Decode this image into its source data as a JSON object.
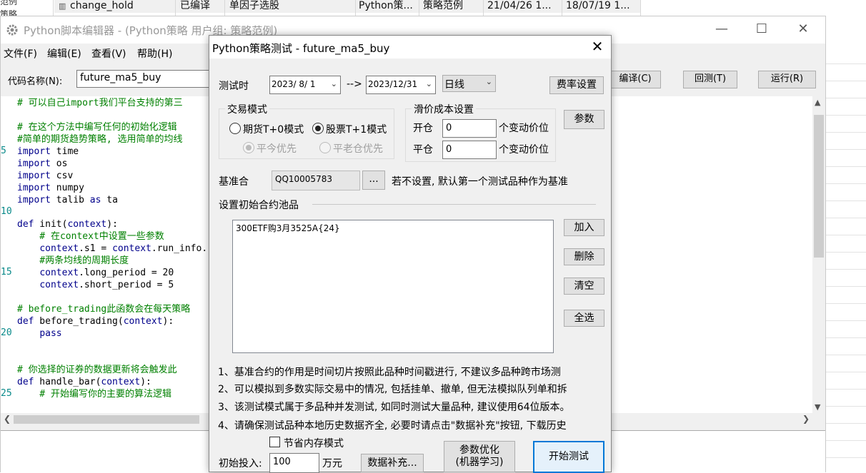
{
  "background_row": {
    "left_fragments": [
      "范例",
      "策略"
    ],
    "name": "change_hold",
    "status": "已编译",
    "category": "单因子选股",
    "language": "Python策...",
    "group": "策略范例",
    "created": "21/04/26 1...",
    "modified": "18/07/19 1..."
  },
  "editor": {
    "title": "Python脚本编辑器 - (Python策略 用户组: 策略范例)",
    "menu": [
      "文件(F)",
      "编辑(E)",
      "查看(V)",
      "帮助(H)"
    ],
    "code_name_label": "代码名称(N):",
    "code_name_value": "future_ma5_buy",
    "buttons": {
      "compile": "编译(C)",
      "backtest": "回测(T)",
      "run": "运行(R)"
    },
    "line_numbers": [
      "5",
      "10",
      "15",
      "20",
      "25"
    ],
    "code_lines": [
      "# 可以自己import我们平台支持的第三",
      "",
      "# 在这个方法中编写任何的初始化逻辑",
      "#简单的期货趋势策略, 选用简单的均线",
      "import time",
      "import os",
      "import csv",
      "import numpy",
      "import talib as ta",
      "",
      "def init(context):",
      "    # 在context中设置一些参数",
      "    context.s1 = context.run_info.",
      "    #两条均线的周期长度",
      "    context.long_period = 20",
      "    context.short_period = 5",
      "",
      "# before_trading此函数会在每天策略",
      "def before_trading(context):",
      "    pass",
      "",
      "",
      "# 你选择的证券的数据更新将会触发此",
      "def handle_bar(context):",
      "    # 开始编写你的主要的算法逻辑"
    ]
  },
  "dialog": {
    "title": "Python策略测试 - future_ma5_buy",
    "test_time_label": "测试时",
    "start_date": "2023/ 8/ 1",
    "arrow": "-->",
    "end_date": "2023/12/31",
    "period": "日线",
    "fee_button": "费率设置",
    "params_button": "参数",
    "trade_mode": {
      "title": "交易模式",
      "futures": "期货T+0模式",
      "stocks": "股票T+1模式",
      "close_today": "平今优先",
      "close_old": "平老仓优先"
    },
    "slippage": {
      "title": "滑价成本设置",
      "open_label": "开仓",
      "open_value": "0",
      "close_label": "平仓",
      "close_value": "0",
      "unit": "个变动价位"
    },
    "benchmark_label": "基准合",
    "benchmark_value": "QQ10005783",
    "browse_button": "...",
    "benchmark_hint": "若不设置, 默认第一个测试品种作为基准",
    "pool_label": "设置初始合约池品",
    "pool_items": [
      "300ETF购3月3525A{24}"
    ],
    "pool_buttons": {
      "add": "加入",
      "delete": "删除",
      "clear": "清空",
      "select_all": "全选"
    },
    "notes": [
      "1、基准合约的作用是时间切片按照此品种时间戳进行, 不建议多品种跨市场测",
      "2、可以模拟到多数实际交易中的情况, 包括挂单、撤单, 但无法模拟队列单和拆",
      "3、该测试模式属于多品种并发测试, 如同时测试大量品种, 建议使用64位版本。",
      "4、请确保测试品种本地历史数据齐全, 必要时请点击\"数据补充\"按钮, 下载历史"
    ],
    "save_memory": "节省内存模式",
    "initial_label": "初始投入:",
    "initial_value": "100",
    "initial_unit": "万元",
    "data_fill_button": "数据补充...",
    "optimize_button_line1": "参数优化",
    "optimize_button_line2": "(机器学习)",
    "start_button": "开始测试"
  }
}
